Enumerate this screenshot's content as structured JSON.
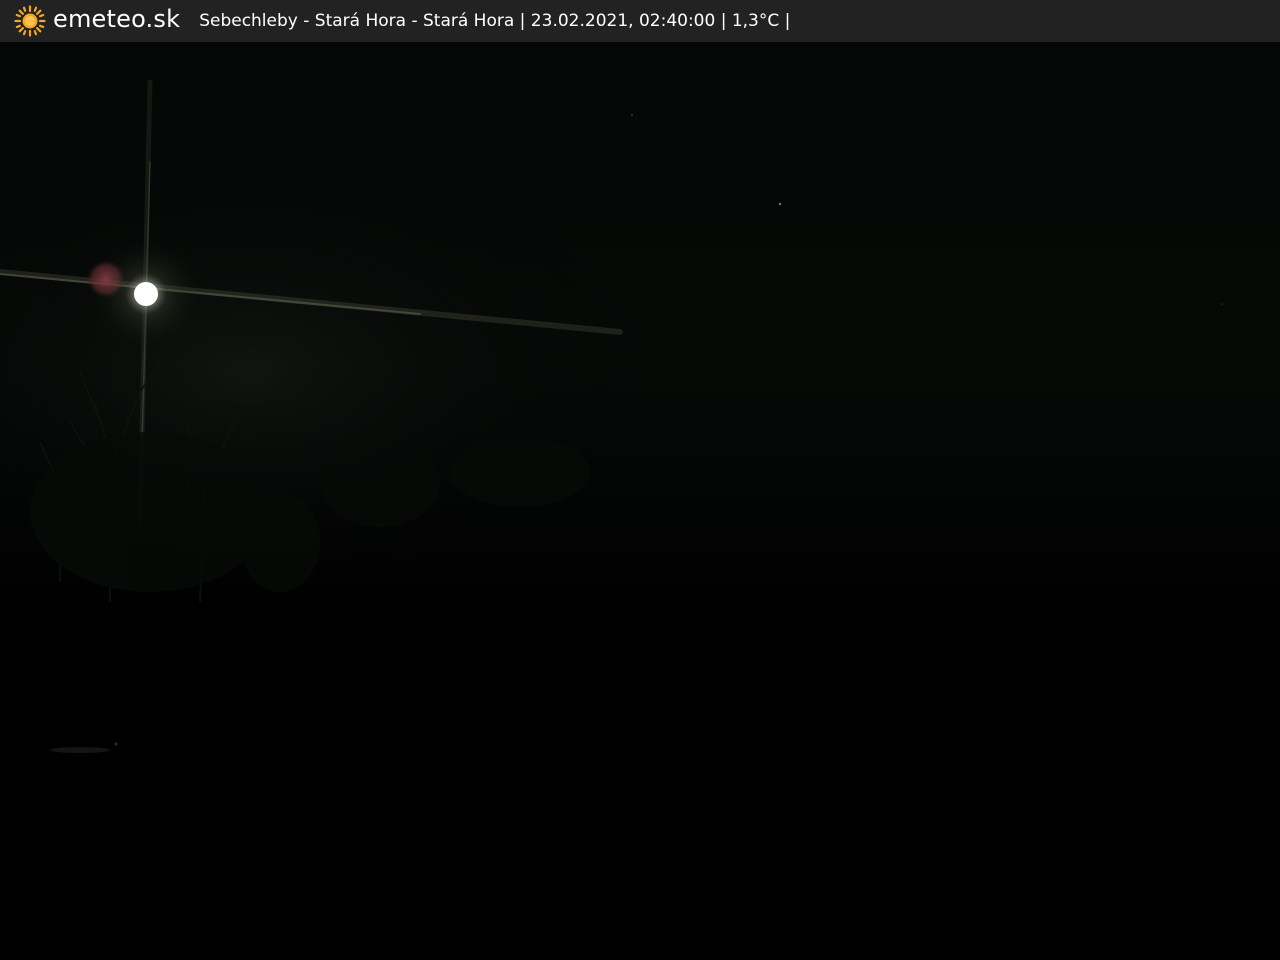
{
  "header": {
    "brand": "emeteo.sk",
    "caption": "Sebechleby - Stará Hora - Stará Hora | 23.02.2021, 02:40:00 | 1,3°C |",
    "logo_icon": "sun-icon",
    "background": "#222222",
    "text_color": "#ffffff",
    "sun_color": "#f5a623"
  },
  "image": {
    "description_icon": "night-webcam-image",
    "sky_color": "#050806",
    "ground_color": "#000000",
    "moon_color": "#ffffff",
    "flare_color": "#8a3a44"
  }
}
